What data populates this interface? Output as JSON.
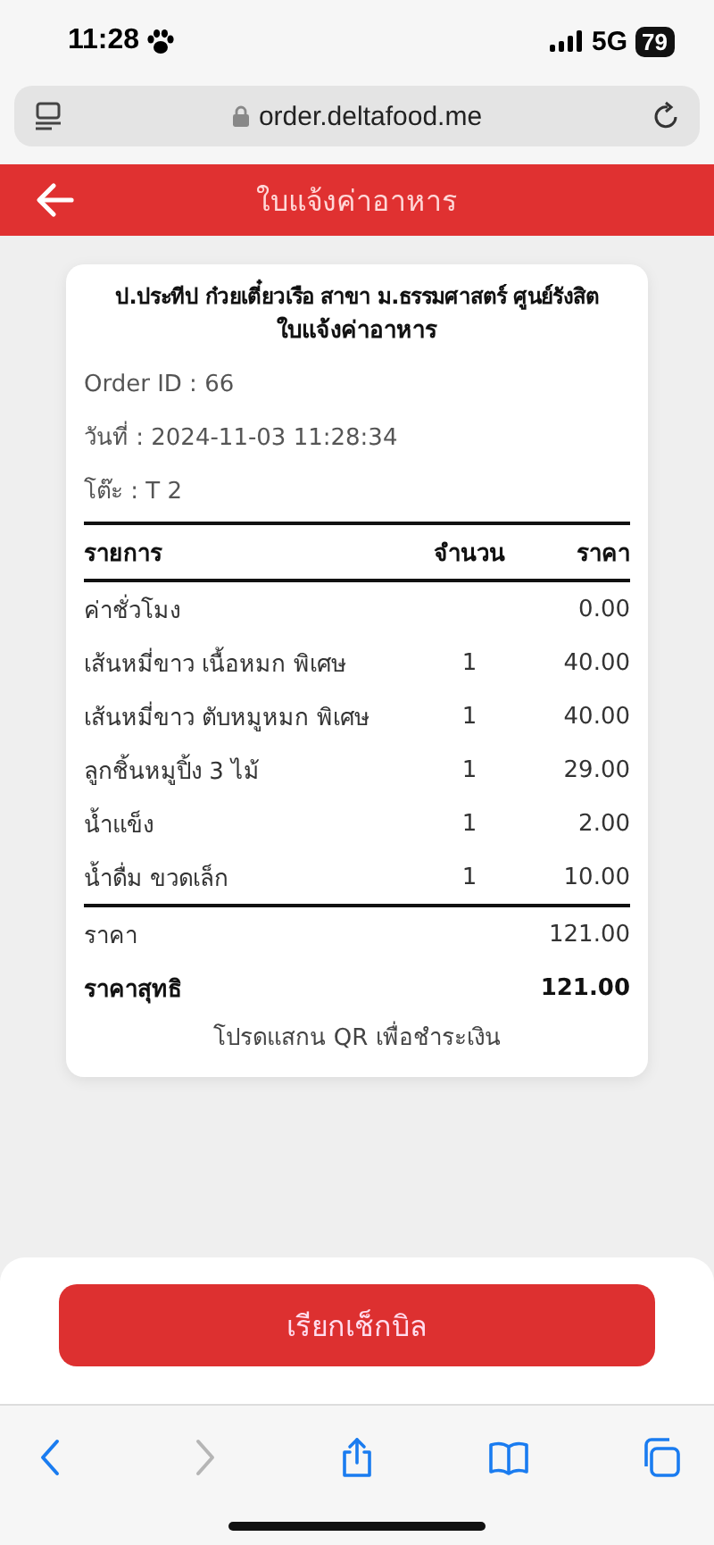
{
  "status_bar": {
    "time": "11:28",
    "network": "5G",
    "battery": "79"
  },
  "browser": {
    "url": "order.deltafood.me"
  },
  "header": {
    "title": "ใบแจ้งค่าอาหาร"
  },
  "receipt": {
    "shop": "ป.ประทีป ก๋วยเตี๋ยวเรือ สาขา ม.ธรรมศาสตร์ ศูนย์รังสิต",
    "title": "ใบแจ้งค่าอาหาร",
    "info": [
      "Order ID : 66",
      "วันที่ : 2024-11-03 11:28:34",
      "โต๊ะ : T 2"
    ],
    "columns": [
      "รายการ",
      "จำนวน",
      "ราคา"
    ],
    "items": [
      {
        "name": "ค่าชั่วโมง",
        "price": "0.00"
      },
      {
        "name": "เส้นหมี่ขาว เนื้อหมก พิเศษ",
        "qty": "1",
        "price": "40.00"
      },
      {
        "name": "เส้นหมี่ขาว ตับหมูหมก พิเศษ",
        "qty": "1",
        "price": "40.00"
      },
      {
        "name": "ลูกชิ้นหมูปิ้ง 3 ไม้",
        "qty": "1",
        "price": "29.00"
      },
      {
        "name": "น้ำแข็ง",
        "qty": "1",
        "price": "2.00"
      },
      {
        "name": "น้ำดื่ม ขวดเล็ก",
        "qty": "1",
        "price": "10.00"
      }
    ],
    "totals": [
      {
        "label": "ราคา",
        "value": "121.00",
        "bold": false
      },
      {
        "label": "ราคาสุทธิ",
        "value": "121.00",
        "bold": true
      }
    ],
    "note": "โปรดแสกน QR เพื่อชำระเงิน"
  },
  "action_button": "เรียกเช็กบิล",
  "toolbar": [
    {
      "kind": "back",
      "disabled": false
    },
    {
      "kind": "forward",
      "disabled": true
    },
    {
      "kind": "share",
      "disabled": false
    },
    {
      "kind": "bookmarks",
      "disabled": false
    },
    {
      "kind": "tabs",
      "disabled": false
    }
  ]
}
